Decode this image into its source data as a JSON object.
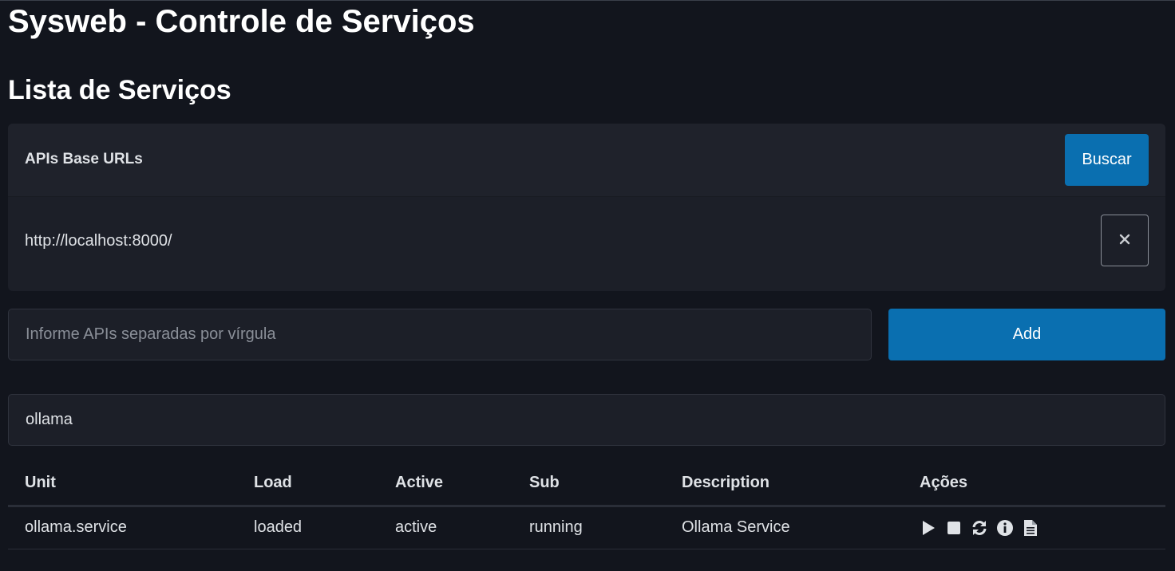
{
  "app": {
    "title": "Sysweb - Controle de Serviços"
  },
  "section": {
    "title": "Lista de Serviços"
  },
  "apis_card": {
    "header_title": "APIs Base URLs",
    "buscar_label": "Buscar",
    "urls": [
      {
        "url": "http://localhost:8000/",
        "remove_icon": "close-icon"
      }
    ]
  },
  "add_form": {
    "placeholder": "Informe APIs separadas por vírgula",
    "value": "",
    "add_label": "Add"
  },
  "filter": {
    "value": "ollama",
    "placeholder": ""
  },
  "table": {
    "columns": [
      "Unit",
      "Load",
      "Active",
      "Sub",
      "Description",
      "Ações"
    ],
    "rows": [
      {
        "unit": "ollama.service",
        "load": "loaded",
        "active": "active",
        "sub": "running",
        "description": "Ollama Service",
        "actions": [
          "play-icon",
          "stop-icon",
          "restart-icon",
          "info-icon",
          "log-file-icon"
        ]
      }
    ]
  },
  "colors": {
    "background": "#12151d",
    "card": "#1c1f28",
    "primary": "#0a6fb0",
    "text": "#dfe2e6"
  }
}
